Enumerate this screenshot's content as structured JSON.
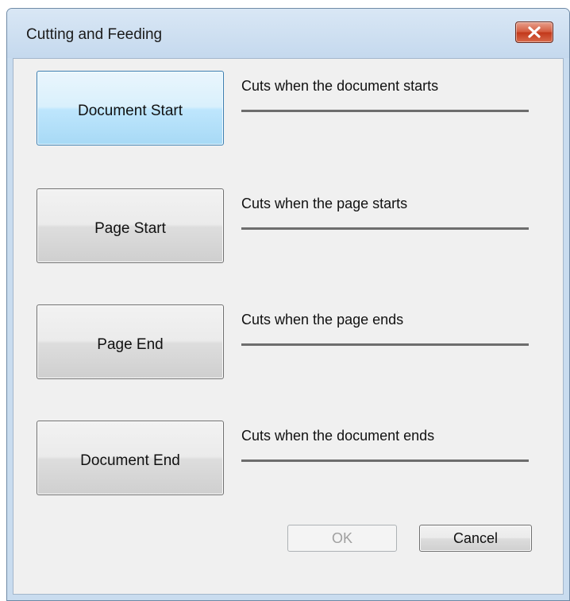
{
  "window": {
    "title": "Cutting and Feeding",
    "close_icon": "close-x-icon"
  },
  "options": [
    {
      "label": "Document Start",
      "description": "Cuts when the document starts",
      "selected": true
    },
    {
      "label": "Page Start",
      "description": "Cuts when the page starts",
      "selected": false
    },
    {
      "label": "Page End",
      "description": "Cuts when the page ends",
      "selected": false
    },
    {
      "label": "Document End",
      "description": "Cuts when the document ends",
      "selected": false
    }
  ],
  "footer": {
    "ok_label": "OK",
    "ok_enabled": false,
    "cancel_label": "Cancel"
  },
  "colors": {
    "selected_button": "#bee6fd",
    "close_button": "#c9452a",
    "dialog_background": "#f0f0f0"
  }
}
